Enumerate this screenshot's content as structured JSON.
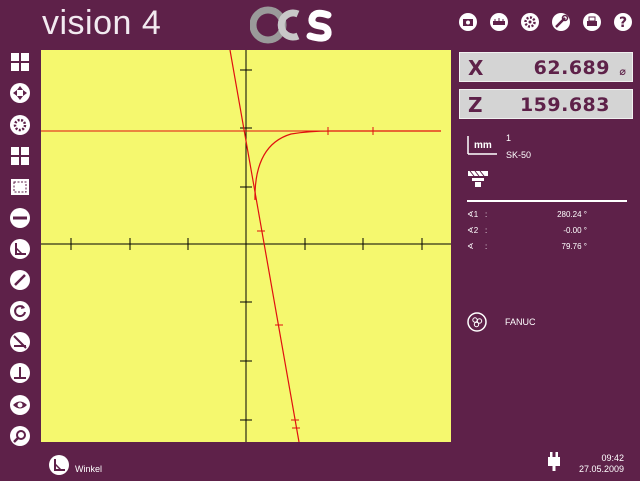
{
  "app": {
    "title": "vision 4",
    "logo_text": "OCS"
  },
  "top_icons": [
    "camera-icon",
    "measure-icon",
    "settings-gear-icon",
    "tools-icon",
    "print-icon",
    "help-icon"
  ],
  "left_tools": [
    "grid-icon",
    "navigate-icon",
    "circle-detect-icon",
    "layout-icon",
    "frame-icon",
    "line-icon",
    "angle-icon",
    "gauge-icon",
    "rotate-icon",
    "intersect-icon",
    "perpendicular-icon",
    "view-eye-icon",
    "zoom-icon"
  ],
  "readouts": {
    "x": {
      "axis": "X",
      "value": "62.689",
      "symbol": "⌀"
    },
    "z": {
      "axis": "Z",
      "value": "159.683"
    }
  },
  "units": {
    "unit": "mm",
    "count": "1",
    "profile": "SK-50"
  },
  "angles": [
    {
      "label": "∢1",
      "value": "280.24 °"
    },
    {
      "label": "∢2",
      "value": "-0.00 °"
    },
    {
      "label": "∢",
      "value": "79.76 °"
    }
  ],
  "machine": {
    "name": "FANUC"
  },
  "status": {
    "mode": "Winkel",
    "time": "09:42",
    "date": "27.05.2009"
  },
  "colors": {
    "background": "#5e2149",
    "plot": "#f5f86e",
    "trace": "#e01010",
    "axis": "#000000"
  }
}
